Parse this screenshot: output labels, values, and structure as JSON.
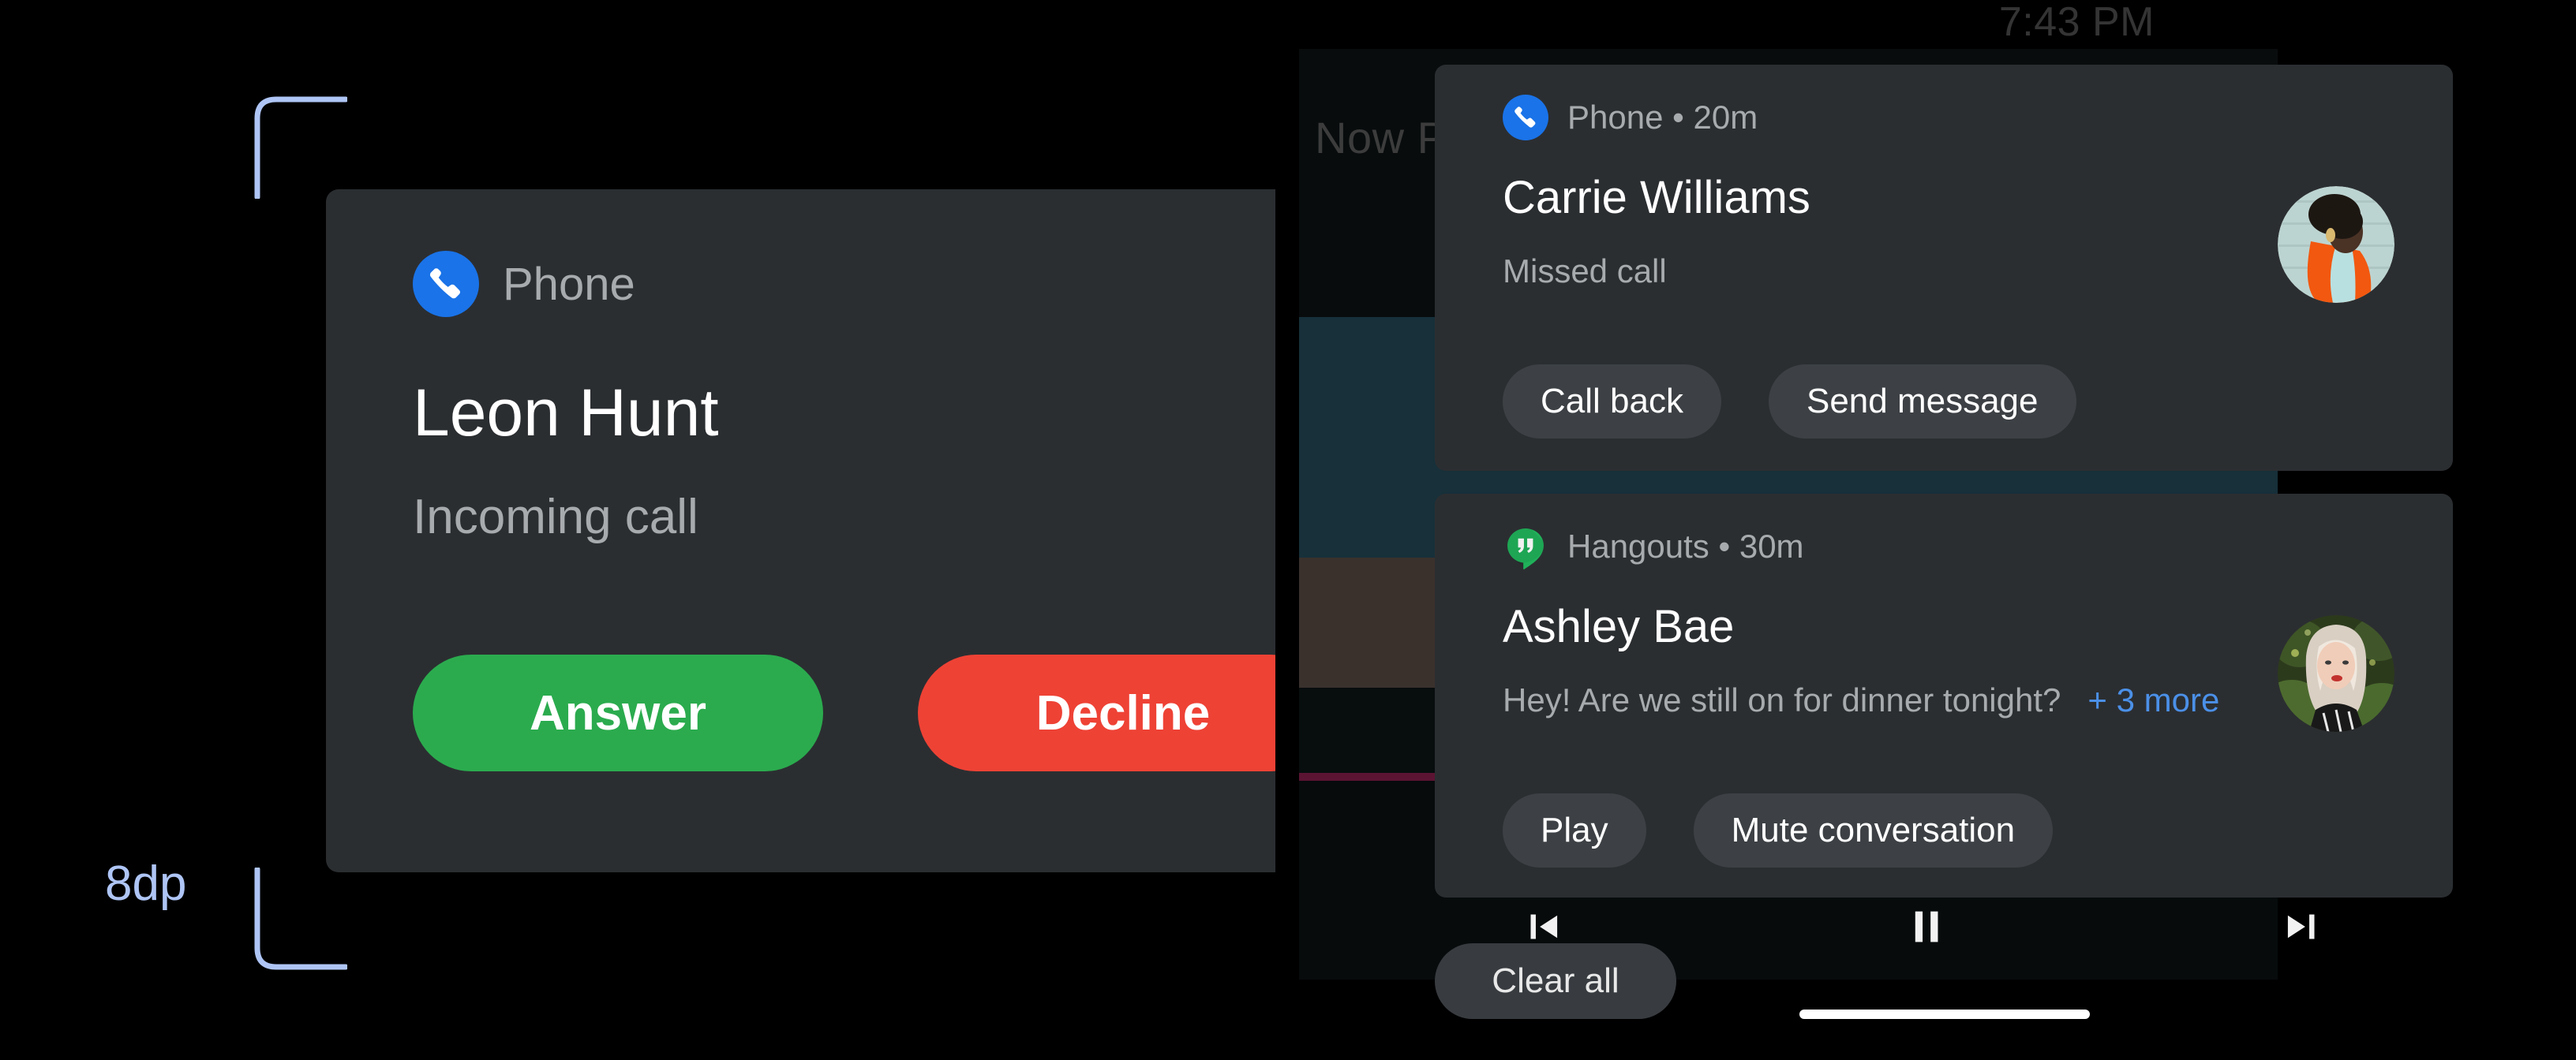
{
  "status_bar": {
    "time": "7:43 PM"
  },
  "background": {
    "media_title": "Now Playing",
    "album_bands": [
      "#080c0d",
      "#17303a",
      "#3a312d",
      "#080d0e",
      "#5c1433",
      "#070b0c"
    ]
  },
  "media_controls": {
    "previous_label": "skip-previous",
    "pause_label": "pause",
    "next_label": "skip-next"
  },
  "heads_up_notification": {
    "app_icon": "phone-icon",
    "app_name": "Phone",
    "title": "Leon Hunt",
    "subtitle": "Incoming call",
    "actions": [
      {
        "label": "Answer",
        "color": "#2bab4e"
      },
      {
        "label": "Decline",
        "color": "#ee4235"
      }
    ]
  },
  "notification_shade": {
    "clear_all_label": "Clear all",
    "notifications": [
      {
        "app_icon": "phone-icon",
        "app_name": "Phone",
        "time": "20m",
        "header": "Phone • 20m",
        "title": "Carrie Williams",
        "subtitle": "Missed call",
        "avatar": "carrie-williams-avatar",
        "actions": [
          {
            "label": "Call back"
          },
          {
            "label": "Send message"
          }
        ]
      },
      {
        "app_icon": "hangouts-icon",
        "app_name": "Hangouts",
        "time": "30m",
        "header": "Hangouts • 30m",
        "title": "Ashley Bae",
        "subtitle": "Hey! Are we still on for dinner tonight?",
        "more_label": "+ 3 more",
        "avatar": "ashley-bae-avatar",
        "actions": [
          {
            "label": "Play"
          },
          {
            "label": "Mute conversation"
          }
        ]
      }
    ]
  },
  "spec_annotation": {
    "label": "8dp",
    "color": "#aec5f5"
  },
  "colors": {
    "card_surface": "#2b2e31",
    "action_chip": "#3d4145",
    "primary_text": "#ffffff",
    "secondary_text": "#a8abae",
    "link": "#4b90e8",
    "phone_blue": "#1a73e8",
    "hangouts_green": "#20b15a"
  }
}
